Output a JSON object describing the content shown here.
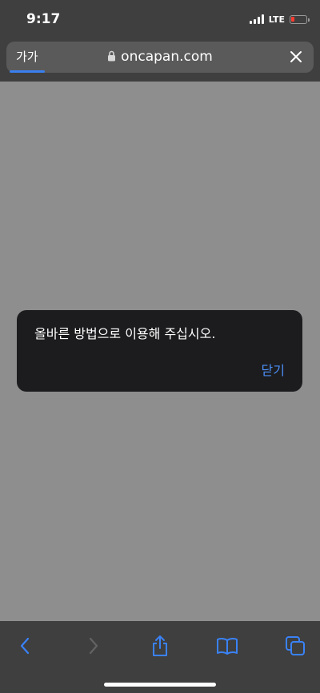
{
  "status_bar": {
    "time": "9:17",
    "network": "LTE",
    "battery_color": "#ff3b30"
  },
  "address_bar": {
    "aa_label": "가가",
    "url": "oncapan.com",
    "lock_icon": "lock-icon",
    "close_icon": "close-icon",
    "accent_color": "#3a7ff0"
  },
  "alert": {
    "message": "올바른 방법으로 이용해 주십시오.",
    "close_label": "닫기",
    "action_color": "#4b8df5"
  },
  "toolbar": {
    "icons": [
      "back-icon",
      "forward-icon",
      "share-icon",
      "bookmarks-icon",
      "tabs-icon"
    ]
  }
}
